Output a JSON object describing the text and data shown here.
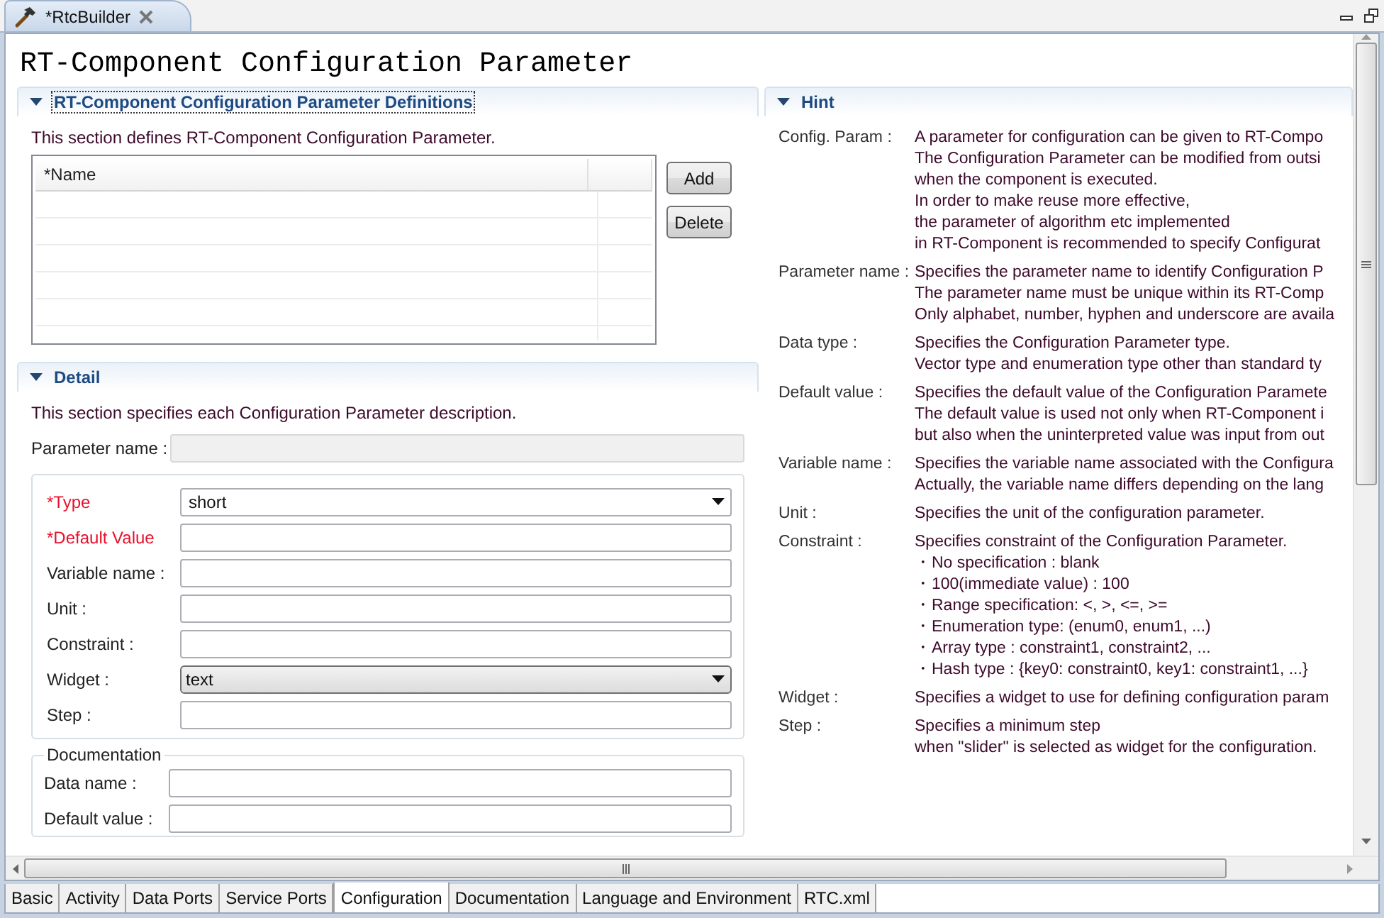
{
  "editor_tab": {
    "title": "*RtcBuilder",
    "selected": true
  },
  "page_title": "RT-Component Configuration Parameter",
  "definitions": {
    "title": "RT-Component Configuration Parameter Definitions",
    "expanded": true,
    "focused": true,
    "description": "This section defines RT-Component Configuration Parameter.",
    "table": {
      "columns": [
        "*Name"
      ]
    },
    "buttons": [
      "Add",
      "Delete"
    ]
  },
  "detail": {
    "title": "Detail",
    "expanded": true,
    "description": "This section specifies each Configuration Parameter description.",
    "parameter_name": {
      "label": "Parameter name :",
      "disabled": true
    },
    "fields": [
      {
        "kind": "combo",
        "label": "*Type",
        "required": true,
        "editable": true,
        "value": "short"
      },
      {
        "kind": "text",
        "label": "*Default Value",
        "required": true
      },
      {
        "kind": "text",
        "label": "Variable name :",
        "required": false
      },
      {
        "kind": "text",
        "label": "Unit :",
        "required": false
      },
      {
        "kind": "text",
        "label": "Constraint :",
        "required": false
      },
      {
        "kind": "combo",
        "label": "Widget :",
        "required": false,
        "editable": false,
        "value": "text"
      },
      {
        "kind": "text",
        "label": "Step :",
        "required": false
      }
    ],
    "documentation": {
      "title": "Documentation",
      "fields": [
        {
          "label": "Data name :"
        },
        {
          "label": "Default value :"
        }
      ]
    }
  },
  "hint": {
    "title": "Hint",
    "expanded": true,
    "rows": [
      {
        "label": "Config. Param :",
        "lines": [
          "A parameter for configuration can be given to RT-Compo",
          "The Configuration Parameter can be modified from outsi",
          "when the component is executed.",
          "In order to make reuse more effective,",
          "the parameter of algorithm etc implemented",
          "in RT-Component is recommended to specify Configurat"
        ]
      },
      {
        "label": "Parameter name :",
        "lines": [
          "Specifies the parameter name to identify Configuration P",
          "The parameter name must be unique within its RT-Comp",
          "Only alphabet, number, hyphen and underscore are availa"
        ]
      },
      {
        "label": "Data type :",
        "lines": [
          "Specifies the Configuration Parameter type.",
          "Vector type and enumeration type other than standard ty"
        ]
      },
      {
        "label": "Default value :",
        "lines": [
          "Specifies the default value of the Configuration Paramete",
          "The default value is used not only when RT-Component i",
          "but also when the uninterpreted value was input from out"
        ]
      },
      {
        "label": "Variable name :",
        "lines": [
          "Specifies the variable name associated with the Configura",
          "Actually, the variable name differs depending on the lang"
        ]
      },
      {
        "label": "Unit :",
        "lines": [
          "Specifies the unit of the configuration parameter."
        ]
      },
      {
        "label": "Constraint :",
        "lines": [
          "Specifies constraint of the Configuration Parameter.",
          "・No specification : blank",
          "・100(immediate value) : 100",
          "・Range specification: <, >, <=, >=",
          "・Enumeration type: (enum0, enum1, ...)",
          "・Array type : constraint1, constraint2, ...",
          "・Hash type : {key0: constraint0, key1: constraint1, ...}"
        ]
      },
      {
        "label": "Widget :",
        "lines": [
          "Specifies a widget to use for defining configuration param"
        ]
      },
      {
        "label": "Step :",
        "lines": [
          "Specifies a minimum step",
          "when \"slider\" is selected as widget for the configuration."
        ]
      }
    ]
  },
  "bottom_tabs": [
    {
      "label": "Basic",
      "selected": false
    },
    {
      "label": "Activity",
      "selected": false
    },
    {
      "label": "Data Ports",
      "selected": false
    },
    {
      "label": "Service Ports",
      "selected": false
    },
    {
      "label": "Configuration",
      "selected": true
    },
    {
      "label": "Documentation",
      "selected": false
    },
    {
      "label": "Language and Environment",
      "selected": false
    },
    {
      "label": "RTC.xml",
      "selected": false
    }
  ]
}
